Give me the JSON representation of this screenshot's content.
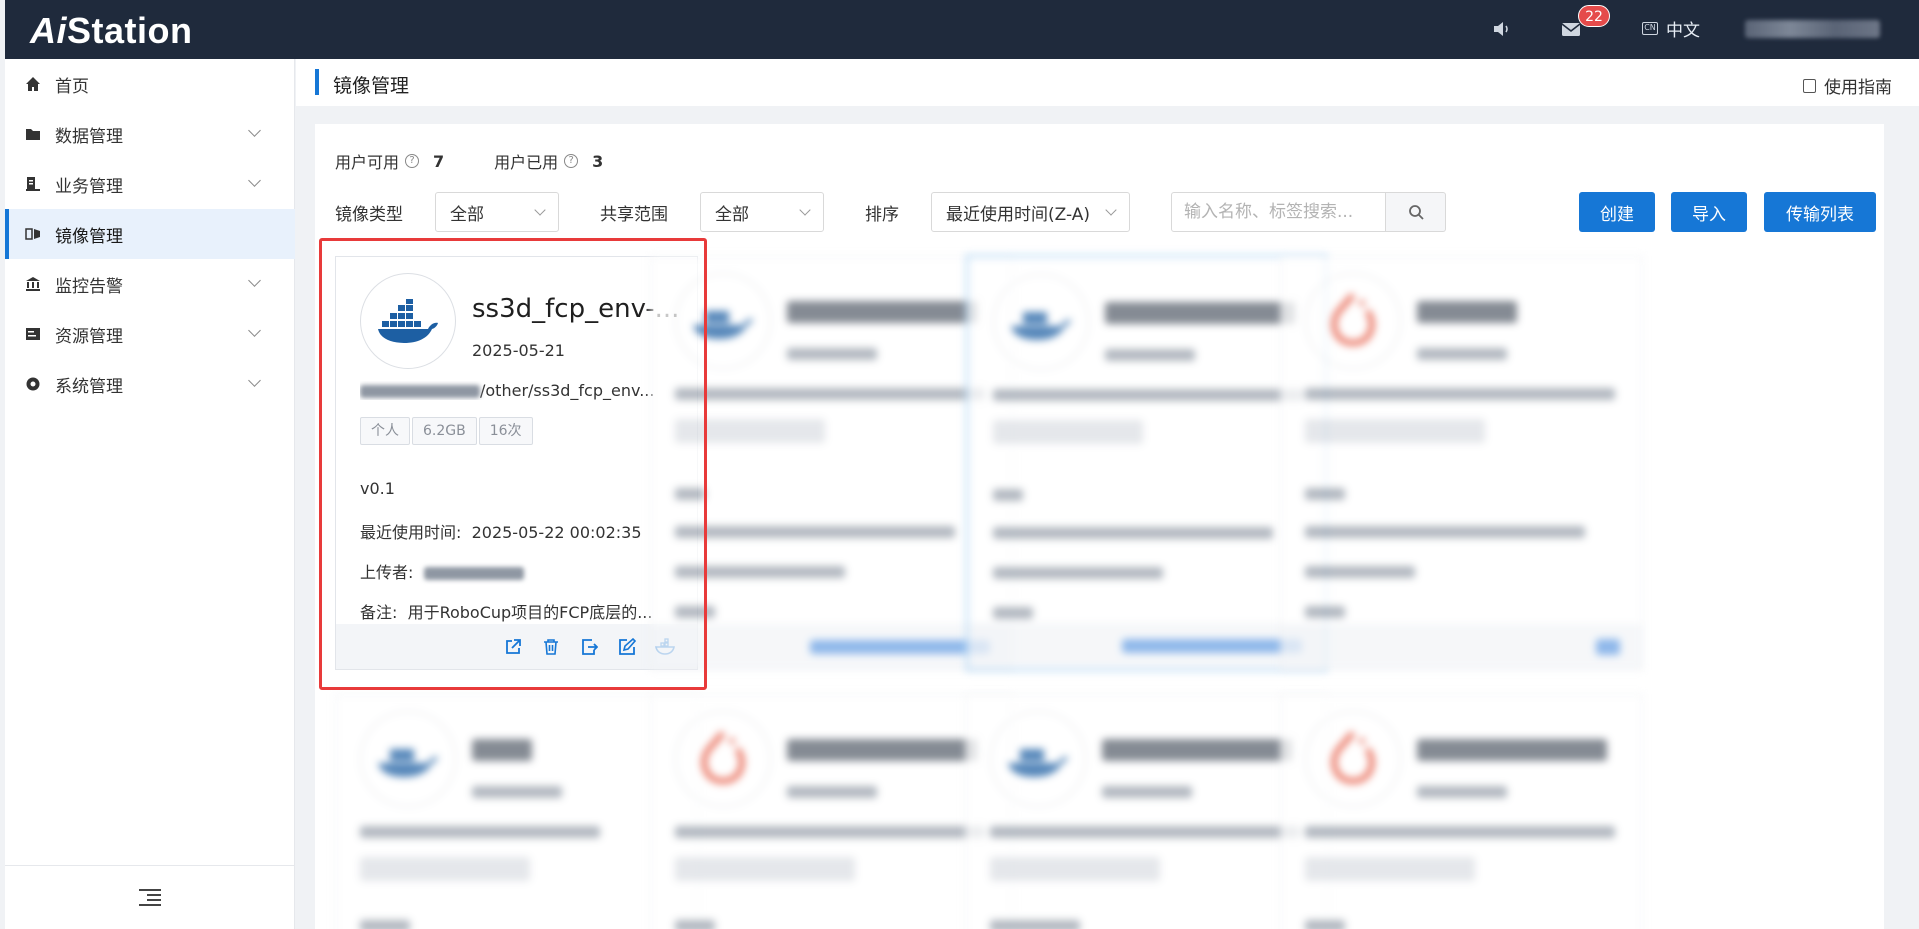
{
  "app": {
    "logo_prefix": "Ai",
    "logo_suffix": "Station"
  },
  "header": {
    "notification_count": "22",
    "language": "中文"
  },
  "sidebar": {
    "items": [
      {
        "label": "首页",
        "icon": "home-icon"
      },
      {
        "label": "数据管理",
        "icon": "folder-icon"
      },
      {
        "label": "业务管理",
        "icon": "business-icon"
      },
      {
        "label": "镜像管理",
        "icon": "image-icon"
      },
      {
        "label": "监控告警",
        "icon": "monitor-icon"
      },
      {
        "label": "资源管理",
        "icon": "resource-icon"
      },
      {
        "label": "系统管理",
        "icon": "settings-icon"
      }
    ]
  },
  "page": {
    "title": "镜像管理",
    "guide": "使用指南"
  },
  "quota": {
    "available_label": "用户可用",
    "available": "7",
    "used_label": "用户已用",
    "used": "3"
  },
  "filters": {
    "type_label": "镜像类型",
    "type_value": "全部",
    "scope_label": "共享范围",
    "scope_value": "全部",
    "sort_label": "排序",
    "sort_value": "最近使用时间(Z-A)",
    "search_placeholder": "输入名称、标签搜索..."
  },
  "buttons": {
    "create": "创建",
    "import": "导入",
    "transfer": "传输列表"
  },
  "card": {
    "name": "ss3d_fcp_env-...",
    "date": "2025-05-21",
    "path": "/other/ss3d_fcp_env...",
    "tags": [
      "个人",
      "6.2GB",
      "16次"
    ],
    "version": "v0.1",
    "last_used_label": "最近使用时间:",
    "last_used": "2025-05-22 00:02:35",
    "uploader_label": "上传者:",
    "note_label": "备注:",
    "note": "用于RoboCup项目的FCP底层的..."
  },
  "colors": {
    "primary": "#1677d6",
    "header": "#1f2a3c",
    "highlight": "#e83a3a"
  }
}
